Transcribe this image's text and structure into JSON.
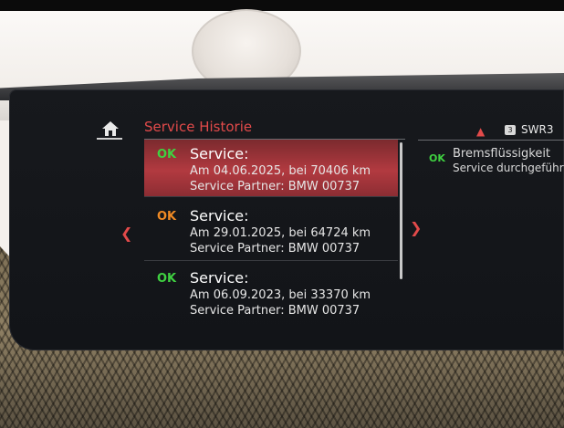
{
  "header": {
    "title": "Service Historie"
  },
  "items": [
    {
      "status": "OK",
      "title": "Service:",
      "line1": "Am 04.06.2025, bei 70406 km",
      "line2": "Service Partner: BMW 00737"
    },
    {
      "status": "OK",
      "title": "Service:",
      "line1": "Am 29.01.2025, bei 64724 km",
      "line2": "Service Partner: BMW 00737"
    },
    {
      "status": "OK",
      "title": "Service:",
      "line1": "Am 06.09.2023, bei 33370 km",
      "line2": "Service Partner: BMW 00737"
    }
  ],
  "right_panel": {
    "status": "OK",
    "title": "Bremsflüssigkeit",
    "subtitle": "Service durchgeführt",
    "radio_preset": "3",
    "radio_station": "SWR3"
  },
  "colors": {
    "accent": "#e24a4a",
    "ok": "#3fd141",
    "warn": "#f08a24",
    "selected_bg": "#b23a40"
  },
  "icons": {
    "home": "home-icon",
    "left": "chevron-left-icon",
    "right": "chevron-right-icon",
    "up": "chevron-up-icon"
  }
}
